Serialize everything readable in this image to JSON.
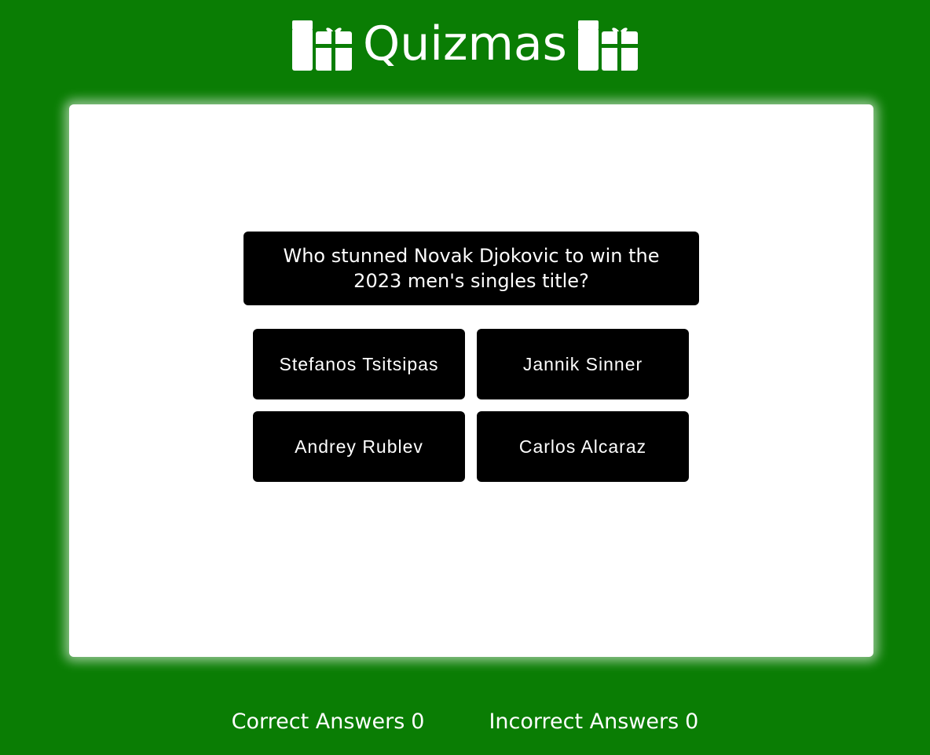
{
  "app": {
    "title": "Quizmas",
    "header_icon": "gift-icon"
  },
  "quiz": {
    "question": "Who stunned Novak Djokovic to win the 2023 men's singles title?",
    "answers": [
      "Stefanos Tsitsipas",
      "Jannik Sinner",
      "Andrey Rublev",
      "Carlos Alcaraz"
    ]
  },
  "scores": {
    "correct_label": "Correct Answers",
    "correct_value": "0",
    "incorrect_label": "Incorrect Answers",
    "incorrect_value": "0"
  },
  "colors": {
    "background": "#0a7d04",
    "card": "#ffffff",
    "button": "#000000",
    "text": "#ffffff"
  }
}
